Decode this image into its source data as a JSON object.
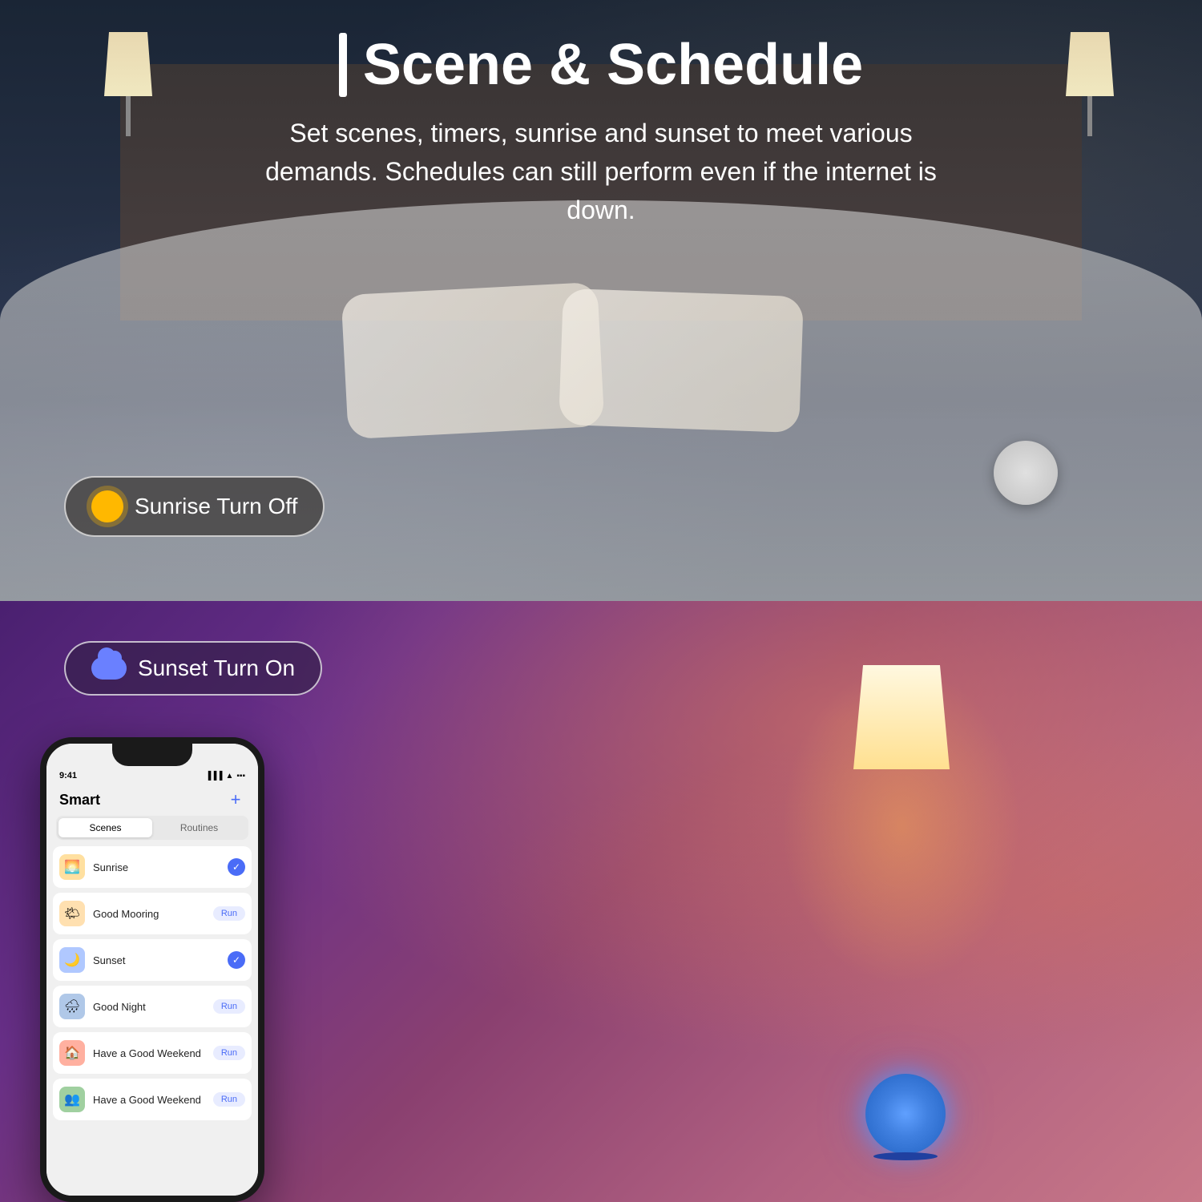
{
  "header": {
    "title_bar": "|",
    "title": "Scene & Schedule",
    "subtitle": "Set scenes, timers, sunrise and sunset to meet various demands. Schedules can still perform even if the internet is down."
  },
  "badges": {
    "sunrise": {
      "text": "Sunrise Turn Off",
      "icon": "sunrise-icon"
    },
    "sunset": {
      "text": "Sunset Turn On",
      "icon": "sunset-cloud-icon"
    }
  },
  "good_night_label": "Good Night",
  "phone": {
    "status_bar": {
      "time": "9:41",
      "signal": "●●●",
      "wifi": "wifi",
      "battery": "battery"
    },
    "title": "Smart",
    "plus_button": "+",
    "tabs": [
      {
        "label": "Scenes",
        "active": true
      },
      {
        "label": "Routines",
        "active": false
      }
    ],
    "scenes": [
      {
        "name": "Sunrise",
        "icon": "🌅",
        "icon_bg": "#FFE0A0",
        "action": "check",
        "action_label": "✓"
      },
      {
        "name": "Good Mooring",
        "icon": "🌤",
        "icon_bg": "#FFE0B0",
        "action": "run",
        "action_label": "Run"
      },
      {
        "name": "Sunset",
        "icon": "🌙",
        "icon_bg": "#B0C8FF",
        "action": "check",
        "action_label": "✓"
      },
      {
        "name": "Good Night",
        "icon": "🌧",
        "icon_bg": "#B0C8E8",
        "action": "run",
        "action_label": "Run"
      },
      {
        "name": "Have a Good Weekend",
        "icon": "🏠",
        "icon_bg": "#FFB0A0",
        "action": "run",
        "action_label": "Run"
      },
      {
        "name": "Have a Good Weekend",
        "icon": "👥",
        "icon_bg": "#A0D0A0",
        "action": "run",
        "action_label": "Run"
      }
    ]
  }
}
